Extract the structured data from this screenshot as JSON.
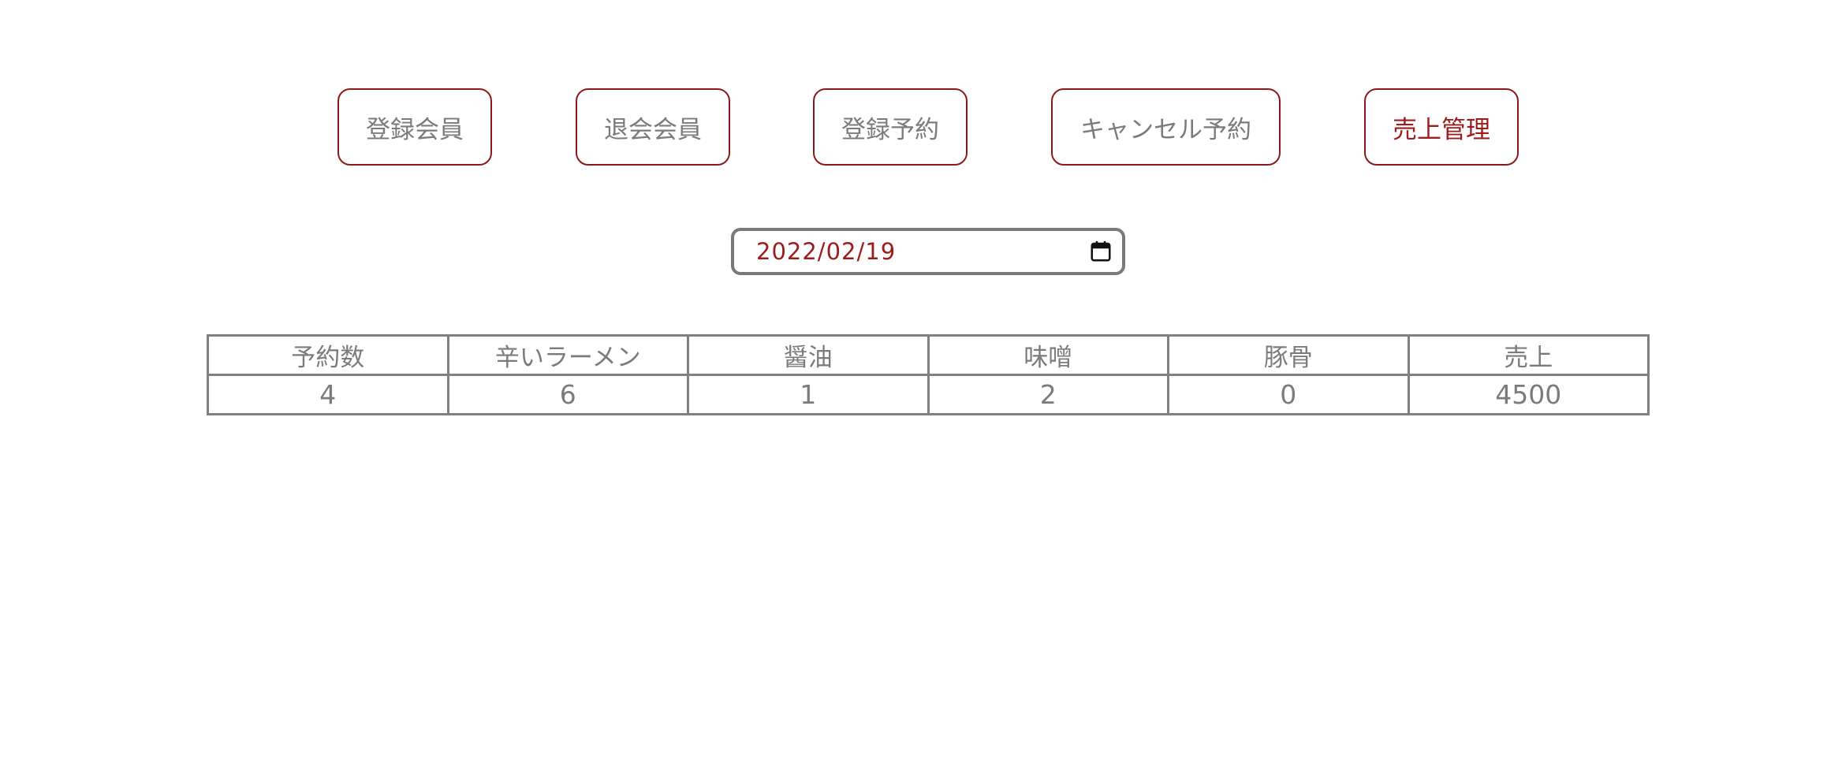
{
  "nav": {
    "items": [
      {
        "label": "登録会員",
        "active": false
      },
      {
        "label": "退会会員",
        "active": false
      },
      {
        "label": "登録予約",
        "active": false
      },
      {
        "label": "キャンセル予約",
        "active": false
      },
      {
        "label": "売上管理",
        "active": true
      }
    ]
  },
  "date_picker": {
    "value": "2022/02/19",
    "icon": "calendar-icon"
  },
  "sales_table": {
    "headers": [
      "予約数",
      "辛いラーメン",
      "醤油",
      "味噌",
      "豚骨",
      "売上"
    ],
    "rows": [
      [
        "4",
        "6",
        "1",
        "2",
        "0",
        "4500"
      ]
    ]
  },
  "colors": {
    "accent": "#9c1c1c",
    "text": "#7b7b7b",
    "border": "#808080",
    "button_border": "#8b1a1a"
  }
}
